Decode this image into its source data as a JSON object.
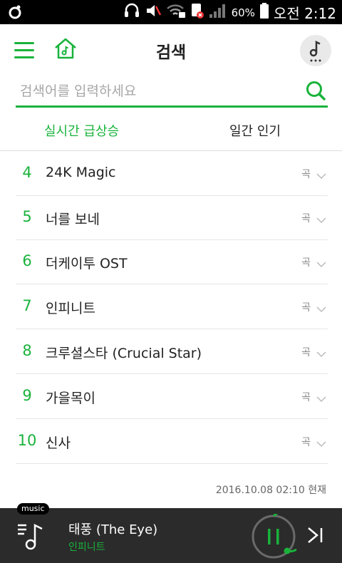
{
  "status_bar": {
    "battery_percent": "60%",
    "time": "오전 2:12"
  },
  "header": {
    "title": "검색"
  },
  "search": {
    "placeholder": "검색어를 입력하세요"
  },
  "tabs": [
    {
      "label": "실시간 급상승",
      "active": true
    },
    {
      "label": "일간 인기",
      "active": false
    }
  ],
  "list": [
    {
      "rank": "4",
      "name": "24K Magic",
      "type": "곡"
    },
    {
      "rank": "5",
      "name": "너를 보네",
      "type": "곡"
    },
    {
      "rank": "6",
      "name": "더케이투 OST",
      "type": "곡"
    },
    {
      "rank": "7",
      "name": "인피니트",
      "type": "곡"
    },
    {
      "rank": "8",
      "name": "크루셜스타 (Crucial Star)",
      "type": "곡"
    },
    {
      "rank": "9",
      "name": "가을목이",
      "type": "곡"
    },
    {
      "rank": "10",
      "name": "신사",
      "type": "곡"
    }
  ],
  "timestamp": "2016.10.08 02:10 현재",
  "player": {
    "badge": "music",
    "song_title": "태풍 (The Eye)",
    "artist": "인피니트"
  },
  "colors": {
    "accent": "#19b33b",
    "player_bg": "#2b2b2b",
    "status_bg": "#000000"
  }
}
